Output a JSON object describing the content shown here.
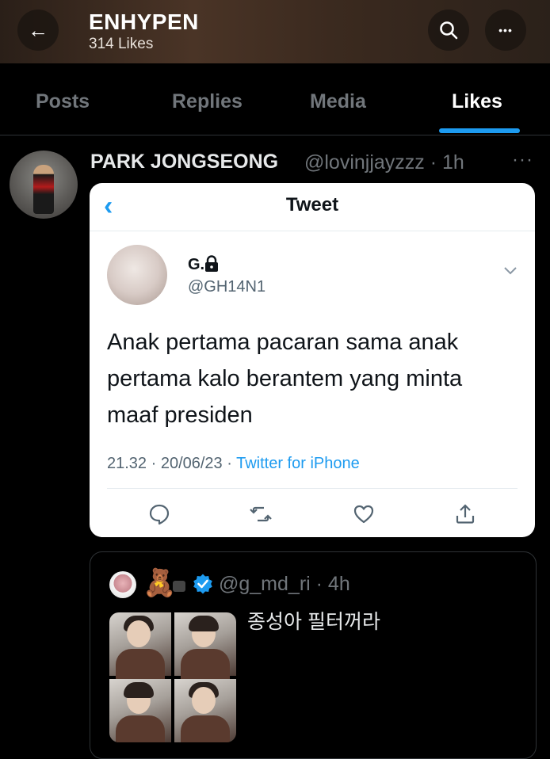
{
  "header": {
    "title": "ENHYPEN",
    "subtitle": "314 Likes",
    "back_icon": "←",
    "search_icon": "⌕",
    "more_icon": "•••"
  },
  "tabs": [
    {
      "label": "Posts",
      "active": false
    },
    {
      "label": "Replies",
      "active": false
    },
    {
      "label": "Media",
      "active": false
    },
    {
      "label": "Likes",
      "active": true
    }
  ],
  "post": {
    "author_name": "PARK JONGSEONG",
    "author_handle": "@lovinjjayzzz · 1h",
    "more": "···",
    "embedded_tweet": {
      "screen_title": "Tweet",
      "back_icon": "‹",
      "name": "G.",
      "handle": "@GH14N1",
      "text": "Anak pertama pacaran sama anak pertama kalo berantem yang minta maaf presiden",
      "time_date": "21.32 · 20/06/23 · ",
      "source": "Twitter for iPhone"
    },
    "quoted": {
      "bear_emoji": "🧸",
      "handle": "@g_md_ri · 4h",
      "text": "종성아 필터꺼라"
    }
  },
  "colors": {
    "accent": "#1d9bf0",
    "background": "#000000",
    "muted": "#71767b"
  }
}
